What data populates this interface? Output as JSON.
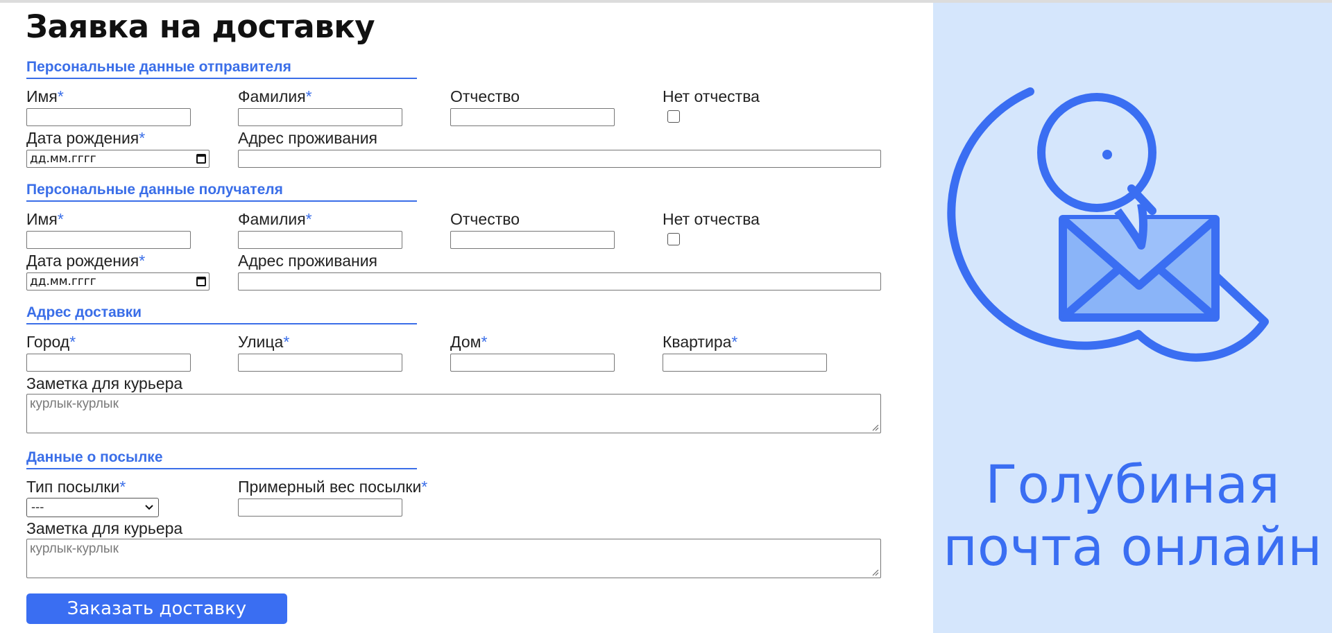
{
  "page": {
    "title": "Заявка на доставку"
  },
  "sender": {
    "section_title": "Персональные данные отправителя",
    "first_name_label": "Имя",
    "last_name_label": "Фамилия",
    "patronymic_label": "Отчество",
    "no_patronymic_label": "Нет отчества",
    "birth_date_label": "Дата рождения",
    "birth_date_placeholder": "дд.мм.гггг",
    "address_label": "Адрес проживания"
  },
  "recipient": {
    "section_title": "Персональные данные получателя",
    "first_name_label": "Имя",
    "last_name_label": "Фамилия",
    "patronymic_label": "Отчество",
    "no_patronymic_label": "Нет отчества",
    "birth_date_label": "Дата рождения",
    "birth_date_placeholder": "дд.мм.гггг",
    "address_label": "Адрес проживания"
  },
  "delivery": {
    "section_title": "Адрес доставки",
    "city_label": "Город",
    "street_label": "Улица",
    "house_label": "Дом",
    "apartment_label": "Квартира",
    "note_label": "Заметка для курьера",
    "note_placeholder": "курлык-курлык"
  },
  "parcel": {
    "section_title": "Данные о посылке",
    "type_label": "Тип посылки",
    "type_selected": "---",
    "weight_label": "Примерный вес посылки",
    "note_label": "Заметка для курьера",
    "note_placeholder": "курлык-курлык"
  },
  "required_marker": "*",
  "submit_label": "Заказать доставку",
  "brand": {
    "line1": "Голубиная",
    "line2": "почта онлайн"
  },
  "icons": {
    "logo": "pigeon-envelope-logo",
    "calendar": "calendar-icon",
    "select": "chevron-down-icon"
  },
  "colors": {
    "accent": "#3a6ef2",
    "panel_bg": "#d5e6fc",
    "envelope_fill": "#8ab4f8"
  }
}
